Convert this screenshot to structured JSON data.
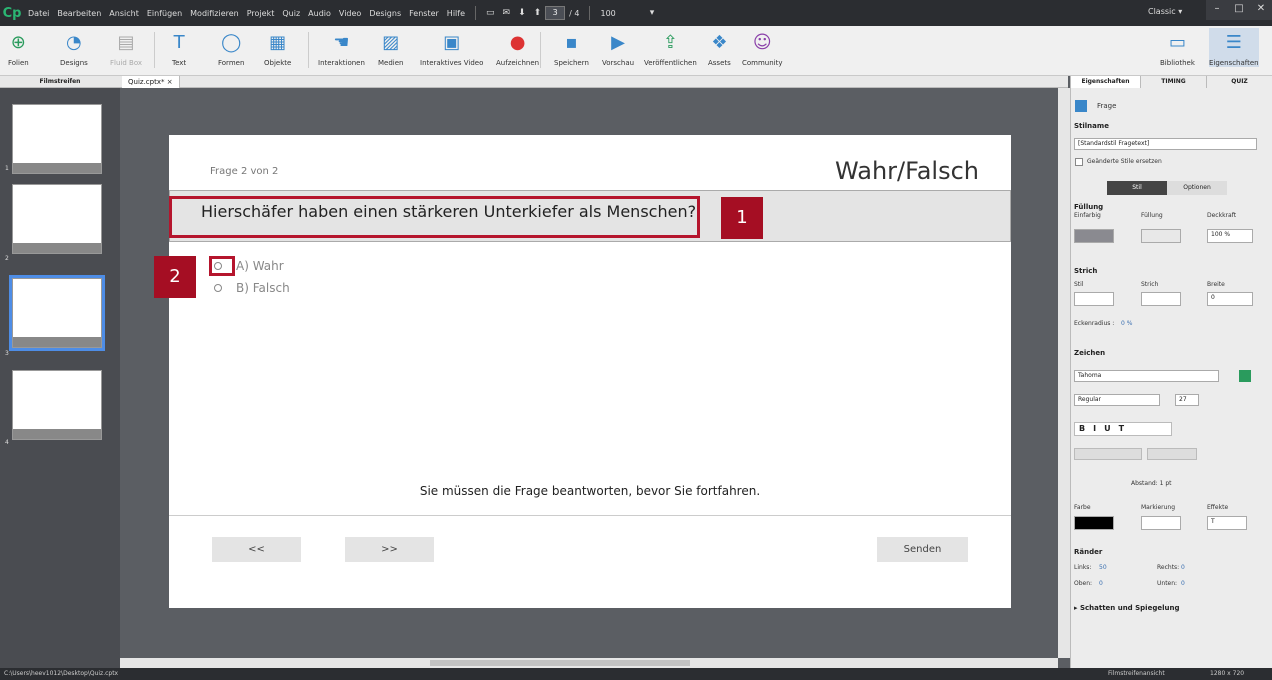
{
  "menubar": {
    "logo": "Cp",
    "items": [
      "Datei",
      "Bearbeiten",
      "Ansicht",
      "Einfügen",
      "Modifizieren",
      "Projekt",
      "Quiz",
      "Audio",
      "Video",
      "Designs",
      "Fenster",
      "Hilfe"
    ],
    "slide_current": "3",
    "slide_total": "/ 4",
    "zoom": "100",
    "workspace": "Classic"
  },
  "toolbar": {
    "folien": "Folien",
    "designs": "Designs",
    "fluid_box": "Fluid Box",
    "text": "Text",
    "formen": "Formen",
    "objekte": "Objekte",
    "interaktionen": "Interaktionen",
    "medien": "Medien",
    "interaktives_video": "Interaktives Video",
    "aufzeichnen": "Aufzeichnen",
    "speichern": "Speichern",
    "vorschau": "Vorschau",
    "veroeffentlichen": "Veröffentlichen",
    "assets": "Assets",
    "community": "Community",
    "bibliothek": "Bibliothek",
    "eigenschaften": "Eigenschaften"
  },
  "filmstrip": {
    "header": "Filmstreifen",
    "numbers": [
      "1",
      "2",
      "3",
      "4"
    ]
  },
  "doc_tab": "Quiz.cptx* ×",
  "slide": {
    "counter": "Frage 2 von 2",
    "title": "Wahr/Falsch",
    "question": "Hierschäfer haben einen stärkeren Unterkiefer als Menschen?",
    "option_a": "A) Wahr",
    "option_b": "B) Falsch",
    "message": "Sie müssen die Frage beantworten, bevor Sie fortfahren.",
    "back": "<<",
    "next": ">>",
    "submit": "Senden"
  },
  "callouts": {
    "one": "1",
    "two": "2"
  },
  "props": {
    "tabs": [
      "Eigenschaften",
      "TIMING",
      "QUIZ"
    ],
    "object_name": "Frage",
    "stilname_label": "Stilname",
    "stilname": "[Standardstil Fragetext]",
    "replace_styles": "Geänderte Stile ersetzen",
    "stil_tab": "Stil",
    "optionen_tab": "Optionen",
    "fuellung": "Füllung",
    "einfarbig": "Einfarbig",
    "fuellung2": "Füllung",
    "deckkraft": "Deckkraft",
    "deckkraft_val": "100 %",
    "strich": "Strich",
    "stil": "Stil",
    "strich2": "Strich",
    "breite": "Breite",
    "breite_val": "0",
    "eckenradius": "Eckenradius :",
    "eckenradius_val": "0 %",
    "zeichen": "Zeichen",
    "font": "Tahoma",
    "weight": "Regular",
    "size": "27",
    "abstand": "Abstand: 1 pt",
    "farbe": "Farbe",
    "markierung": "Markierung",
    "effekte": "Effekte",
    "effekte_val": "T",
    "raender": "Ränder",
    "links": "Links:",
    "links_val": "50",
    "rechts": "Rechts:",
    "rechts_val": "0",
    "oben": "Oben:",
    "oben_val": "0",
    "unten": "Unten:",
    "unten_val": "0",
    "schatten": "▸ Schatten und Spiegelung"
  },
  "status": {
    "path": "C:\\Users\\heev1012\\Desktop\\Quiz.cptx",
    "view": "Filmstreifenansicht",
    "size": "1280 x 720"
  }
}
